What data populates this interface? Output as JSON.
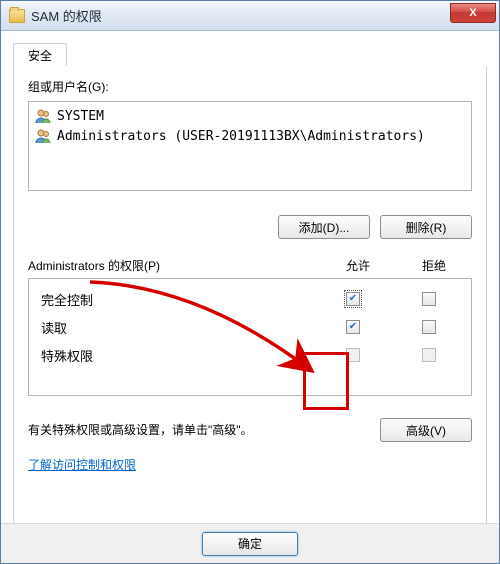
{
  "window": {
    "title": "SAM 的权限",
    "close_glyph": "X"
  },
  "tab": {
    "security": "安全"
  },
  "groups_label": "组或用户名(G):",
  "users": [
    {
      "name": "SYSTEM"
    },
    {
      "name": "Administrators (USER-20191113BX\\Administrators)"
    }
  ],
  "buttons": {
    "add": "添加(D)...",
    "remove": "删除(R)",
    "advanced": "高级(V)",
    "ok": "确定"
  },
  "perm": {
    "label": "Administrators 的权限(P)",
    "col_allow": "允许",
    "col_deny": "拒绝",
    "rows": [
      {
        "name": "完全控制",
        "allow": true,
        "deny": false,
        "focused": true
      },
      {
        "name": "读取",
        "allow": true,
        "deny": false
      },
      {
        "name": "特殊权限",
        "allow": false,
        "deny": false,
        "disabled": true
      }
    ]
  },
  "advtext": "有关特殊权限或高级设置，请单击\"高级\"。",
  "link": "了解访问控制和权限"
}
